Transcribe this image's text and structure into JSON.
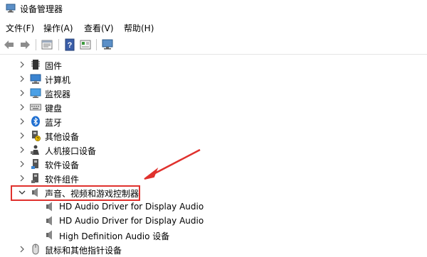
{
  "window": {
    "title": "设备管理器"
  },
  "menu": [
    {
      "label": "文件(F)"
    },
    {
      "label": "操作(A)"
    },
    {
      "label": "查看(V)"
    },
    {
      "label": "帮助(H)"
    }
  ],
  "toolbar": {
    "buttons": [
      "back-arrow-icon",
      "forward-arrow-icon",
      "properties-sheet-icon",
      "help-icon",
      "driver-update-icon",
      "monitor-scan-icon"
    ]
  },
  "tree": {
    "rows": [
      {
        "label": "固件",
        "icon": "firmware-icon",
        "expanded": false
      },
      {
        "label": "计算机",
        "icon": "computer-icon",
        "expanded": false
      },
      {
        "label": "监视器",
        "icon": "monitor-icon",
        "expanded": false
      },
      {
        "label": "键盘",
        "icon": "keyboard-icon",
        "expanded": false
      },
      {
        "label": "蓝牙",
        "icon": "bluetooth-icon",
        "expanded": false
      },
      {
        "label": "其他设备",
        "icon": "other-devices-icon",
        "expanded": false
      },
      {
        "label": "人机接口设备",
        "icon": "hid-icon",
        "expanded": false
      },
      {
        "label": "软件设备",
        "icon": "software-device-icon",
        "expanded": false
      },
      {
        "label": "软件组件",
        "icon": "software-component-icon",
        "expanded": false
      },
      {
        "label": "声音、视频和游戏控制器",
        "icon": "speaker-icon",
        "expanded": true
      },
      {
        "label": "HD Audio Driver for Display Audio",
        "icon": "speaker-icon",
        "child": true
      },
      {
        "label": "HD Audio Driver for Display Audio",
        "icon": "speaker-icon",
        "child": true
      },
      {
        "label": "High Definition Audio 设备",
        "icon": "speaker-icon",
        "child": true
      },
      {
        "label": "鼠标和其他指针设备",
        "icon": "mouse-icon",
        "expanded": false
      }
    ]
  },
  "annotation": {
    "color": "#e0312d"
  }
}
